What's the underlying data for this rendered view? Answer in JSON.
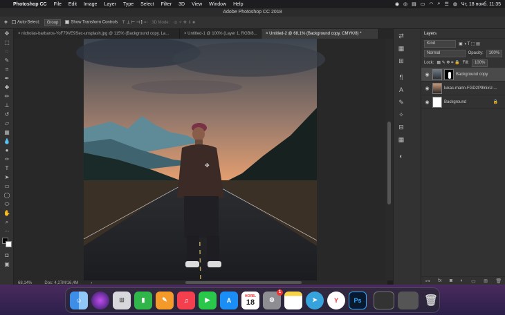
{
  "menubar": {
    "app": "Photoshop CC",
    "items": [
      "File",
      "Edit",
      "Image",
      "Layer",
      "Type",
      "Select",
      "Filter",
      "3D",
      "View",
      "Window",
      "Help"
    ],
    "clock": "Чт, 18 нояб. 11:35"
  },
  "window": {
    "title": "Adobe Photoshop CC 2018"
  },
  "options": {
    "auto_select_label": "Auto-Select:",
    "auto_select_value": "Group",
    "transform_label": "Show Transform Controls",
    "mode_3d": "3D Mode:"
  },
  "tabs": [
    {
      "label": "nicholas-barbaros-YoF79VE9Sec-unsplash.jpg @ 115% (Background copy, La...",
      "active": false
    },
    {
      "label": "Untitled-1 @ 100% (Layer 1, RGB/8...",
      "active": false
    },
    {
      "label": "Untitled-2 @ 68,1% (Background copy, CMYK/8) *",
      "active": true
    }
  ],
  "status": {
    "zoom": "68,14%",
    "doc": "Doc: 4,27M/16,4M"
  },
  "layers_panel": {
    "title": "Layers",
    "kind": "Kind",
    "blend_mode": "Normal",
    "opacity_label": "Opacity:",
    "opacity_value": "100%",
    "lock_label": "Lock:",
    "fill_label": "Fill:",
    "fill_value": "100%",
    "layers": [
      {
        "name": "Background copy",
        "selected": true
      },
      {
        "name": "lukas-mann-FGD2P9lnixU-...",
        "selected": false
      },
      {
        "name": "Background",
        "selected": false
      }
    ]
  },
  "dock": {
    "apps": [
      "Finder",
      "Siri",
      "Launchpad",
      "Numbers",
      "Pages",
      "Music",
      "FaceTime",
      "App Store",
      "Calendar",
      "System Preferences",
      "Notes",
      "Telegram",
      "Yandex",
      "Photoshop"
    ],
    "calendar_month": "НОЯБ.",
    "calendar_day": "18",
    "badge": "1"
  }
}
